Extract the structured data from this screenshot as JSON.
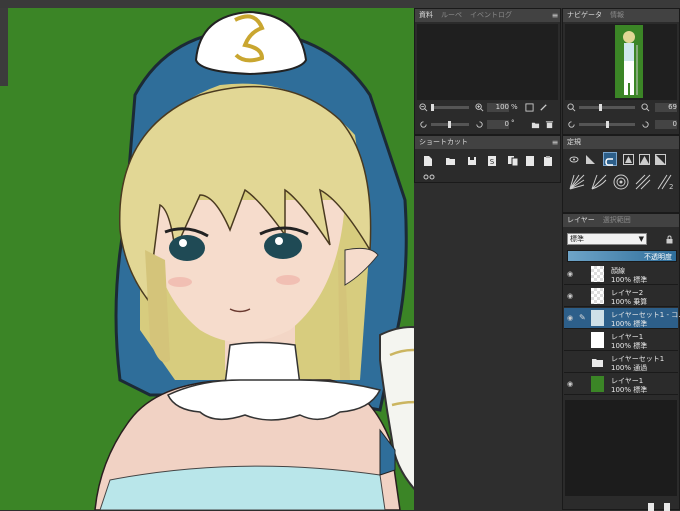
{
  "materials_panel": {
    "tabs": [
      "資料",
      "ルーペ",
      "イベントログ"
    ],
    "zoom_value": "100",
    "zoom_unit": "%",
    "rotate_value": "0",
    "rotate_unit": "°"
  },
  "navigator_panel": {
    "tabs": [
      "ナビゲータ",
      "情報"
    ],
    "zoom_value": "69",
    "rotate_value": "0"
  },
  "shortcut_panel": {
    "tabs": [
      "ショートカット"
    ]
  },
  "ruler_panel": {
    "tabs": [
      "定規"
    ]
  },
  "layer_panel": {
    "tabs": [
      "レイヤー",
      "選択範囲"
    ],
    "blend_mode": "標準",
    "opacity_label": "不透明度",
    "layers": [
      {
        "name": "顔線",
        "mode": "100% 標準"
      },
      {
        "name": "レイヤー2",
        "mode": "100% 乗算"
      },
      {
        "name": "レイヤーセット1 - コ…",
        "mode": "100% 標準"
      },
      {
        "name": "レイヤー1",
        "mode": "100% 標準"
      },
      {
        "name": "レイヤーセット1",
        "mode": "100% 通過"
      },
      {
        "name": "レイヤー1",
        "mode": "100% 標準"
      }
    ]
  },
  "colors": {
    "canvas_bg": "#3b8526",
    "panel_bg": "#2b2b2b",
    "selected_layer": "#2d5f8a",
    "accent_blue": "#3a6d8f"
  }
}
